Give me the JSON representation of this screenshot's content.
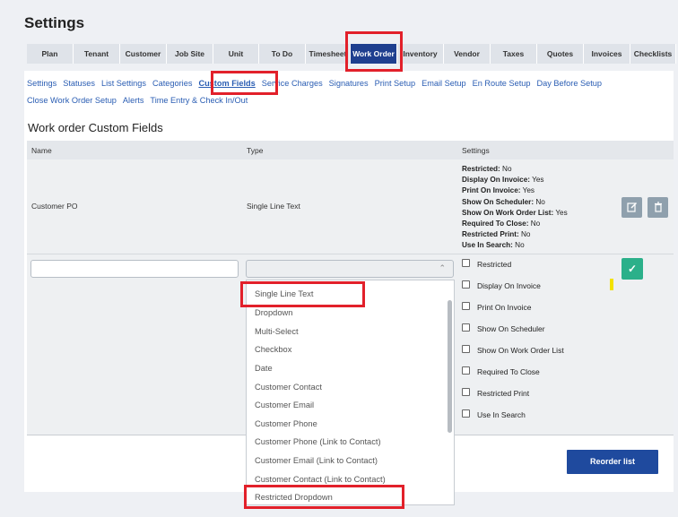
{
  "page_title": "Settings",
  "module_tabs": [
    "Plan",
    "Tenant",
    "Customer",
    "Job Site",
    "Unit",
    "To Do",
    "Timesheet",
    "Work Order",
    "Inventory",
    "Vendor",
    "Taxes",
    "Quotes",
    "Invoices",
    "Checklists"
  ],
  "active_module_tab": "Work Order",
  "sub_tabs_row1": [
    "Settings",
    "Statuses",
    "List Settings",
    "Categories",
    "Custom Fields",
    "Service Charges",
    "Signatures",
    "Print Setup",
    "Email Setup",
    "En Route Setup",
    "Day Before Setup"
  ],
  "sub_tabs_row2": [
    "Close Work Order Setup",
    "Alerts",
    "Time Entry & Check In/Out"
  ],
  "active_sub_tab": "Custom Fields",
  "section_title": "Work order Custom Fields",
  "table": {
    "col_name": "Name",
    "col_type": "Type",
    "col_settings": "Settings"
  },
  "field_row": {
    "name": "Customer PO",
    "type": "Single Line Text",
    "settings": [
      {
        "label": "Restricted:",
        "value": " No"
      },
      {
        "label": "Display On Invoice:",
        "value": " Yes"
      },
      {
        "label": "Print On Invoice:",
        "value": " Yes"
      },
      {
        "label": "Show On Scheduler:",
        "value": " No"
      },
      {
        "label": "Show On Work Order List:",
        "value": " Yes"
      },
      {
        "label": "Required To Close:",
        "value": " No"
      },
      {
        "label": "Restricted Print:",
        "value": " No"
      },
      {
        "label": "Use In Search:",
        "value": " No"
      }
    ]
  },
  "new_row": {
    "name_value": "",
    "type_value": "",
    "checkboxes": [
      "Restricted",
      "Display On Invoice",
      "Print On Invoice",
      "Show On Scheduler",
      "Show On Work Order List",
      "Required To Close",
      "Restricted Print",
      "Use In Search"
    ]
  },
  "type_options": [
    "Single Line Text",
    "Dropdown",
    "Multi-Select",
    "Checkbox",
    "Date",
    "Customer Contact",
    "Customer Email",
    "Customer Phone",
    "Customer Phone (Link to Contact)",
    "Customer Email (Link to Contact)",
    "Customer Contact (Link to Contact)",
    "Restricted Dropdown"
  ],
  "reorder_label": "Reorder list",
  "icons": {
    "edit": "edit-icon",
    "delete": "trash-icon",
    "save": "check-icon",
    "select": "chevron-up-icon"
  },
  "colors": {
    "accent": "#1f3f8f",
    "link": "#2a5db3",
    "success": "#2bb08a",
    "highlight": "#e2202a"
  }
}
